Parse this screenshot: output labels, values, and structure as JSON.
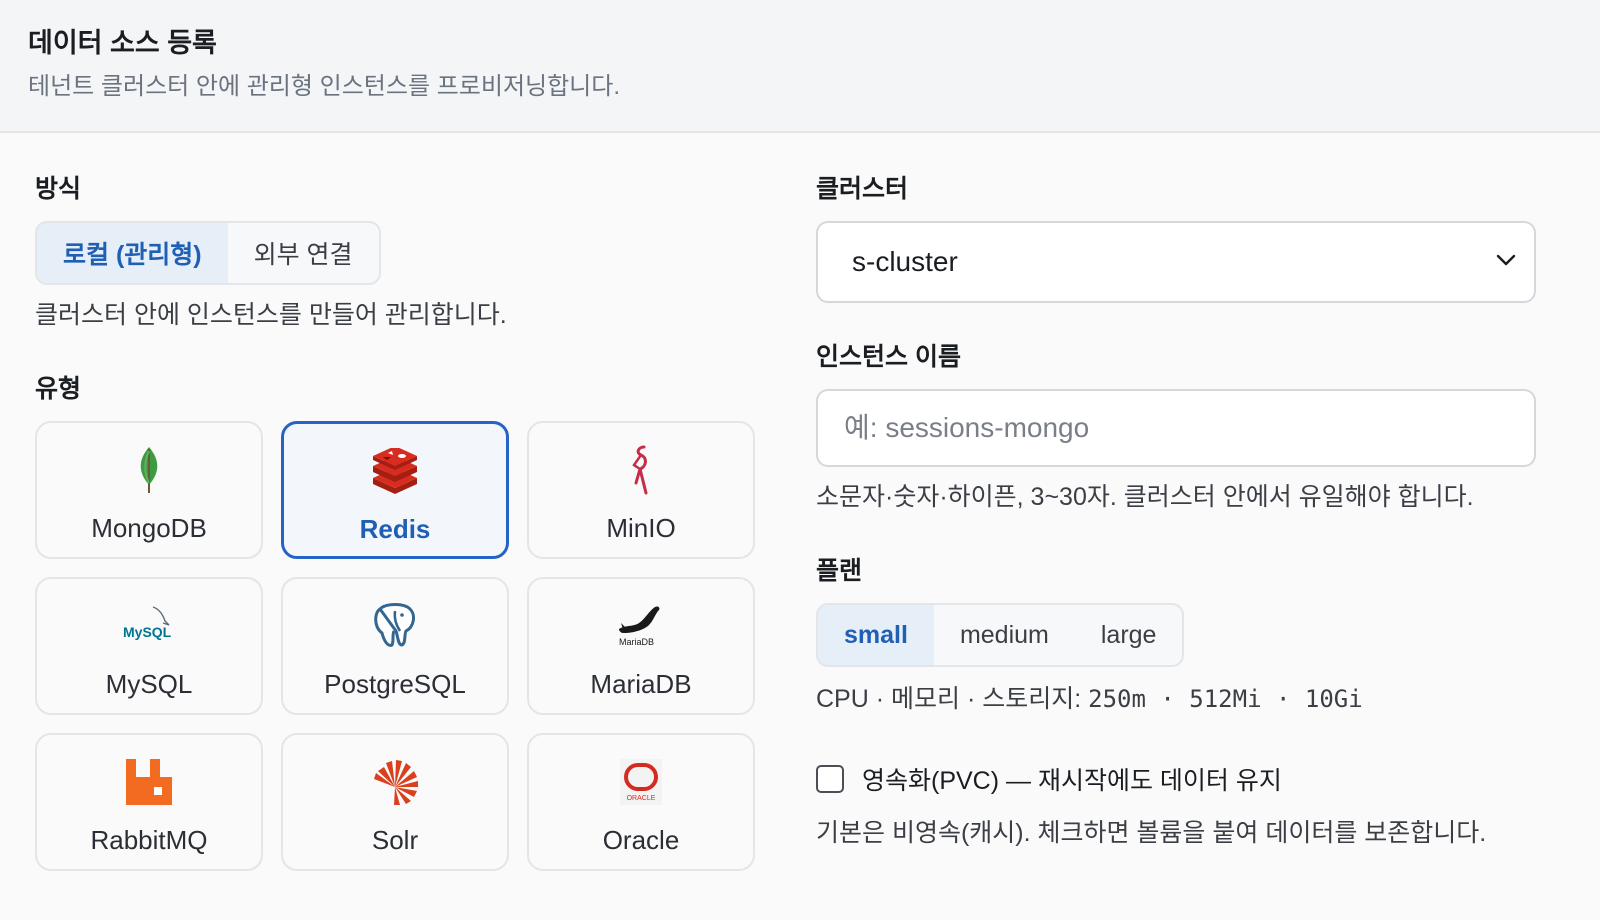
{
  "header": {
    "title": "데이터 소스 등록",
    "subtitle": "테넌트 클러스터 안에 관리형 인스턴스를 프로비저닝합니다."
  },
  "mode": {
    "label": "방식",
    "options": [
      "로컬 (관리형)",
      "외부 연결"
    ],
    "selected": "로컬 (관리형)",
    "help": "클러스터 안에 인스턴스를 만들어 관리합니다."
  },
  "type": {
    "label": "유형",
    "selected": "Redis",
    "items": [
      {
        "name": "MongoDB",
        "icon": "mongodb-leaf-icon"
      },
      {
        "name": "Redis",
        "icon": "redis-icon"
      },
      {
        "name": "MinIO",
        "icon": "minio-icon"
      },
      {
        "name": "MySQL",
        "icon": "mysql-icon",
        "logo_text": "MySQL"
      },
      {
        "name": "PostgreSQL",
        "icon": "postgresql-elephant-icon"
      },
      {
        "name": "MariaDB",
        "icon": "mariadb-seal-icon",
        "logo_text": "MariaDB"
      },
      {
        "name": "RabbitMQ",
        "icon": "rabbitmq-icon"
      },
      {
        "name": "Solr",
        "icon": "solr-icon"
      },
      {
        "name": "Oracle",
        "icon": "oracle-icon",
        "logo_text": "ORACLE"
      }
    ]
  },
  "cluster": {
    "label": "클러스터",
    "value": "s-cluster"
  },
  "instance": {
    "label": "인스턴스 이름",
    "placeholder": "예: sessions-mongo",
    "value": "",
    "help": "소문자·숫자·하이픈, 3~30자. 클러스터 안에서 유일해야 합니다."
  },
  "plan": {
    "label": "플랜",
    "options": [
      "small",
      "medium",
      "large"
    ],
    "selected": "small",
    "spec_label": "CPU · 메모리 · 스토리지:",
    "spec_value": "250m · 512Mi · 10Gi"
  },
  "persistence": {
    "checked": false,
    "label": "영속화(PVC) — 재시작에도 데이터 유지",
    "help": "기본은 비영속(캐시). 체크하면 볼륨을 붙여 데이터를 보존합니다."
  },
  "colors": {
    "accent": "#1f5fb4",
    "selected_border": "#2563c7",
    "mongodb": "#3f9b41",
    "redis": "#c6302b",
    "minio": "#c72c48",
    "mysql": "#00758f",
    "postgresql": "#336791",
    "rabbitmq": "#f26b21",
    "solr": "#d9411e",
    "oracle": "#c74634"
  }
}
